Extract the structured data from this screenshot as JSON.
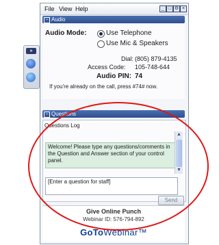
{
  "menu": {
    "file": "File",
    "view": "View",
    "help": "Help"
  },
  "window_controls": {
    "minimize": "_",
    "restore": "□",
    "options": "⚙",
    "close": "×"
  },
  "audio": {
    "section_title": "Audio",
    "mode_label": "Audio Mode:",
    "options": [
      "Use Telephone",
      "Use Mic & Speakers"
    ],
    "selected": "Use Telephone",
    "dial_label": "Dial:",
    "dial_value": "(805) 879-4135",
    "access_code_label": "Access Code:",
    "access_code_value": "105-748-644",
    "pin_label": "Audio PIN:",
    "pin_value": "74",
    "note": "If you're already on the call, press #74# now."
  },
  "questions": {
    "section_title": "Questions",
    "log_title": "Questions Log",
    "welcome_message": "Welcome! Please type any questions/comments in the Question and Answer section of your control panel.",
    "input_placeholder": "[Enter a question for staff]",
    "send_label": "Send"
  },
  "footer": {
    "webinar_title": "Give Online Punch",
    "webinar_id_label": "Webinar ID:",
    "webinar_id_value": "576-794-892",
    "brand_bold": "GoTo",
    "brand_light": "Webinar™"
  },
  "mini_toolbar": {
    "expand": "»"
  },
  "colors": {
    "accent": "#2f4f8f",
    "highlight_ellipse": "#e01616",
    "message_bg": "#dbeee0"
  }
}
